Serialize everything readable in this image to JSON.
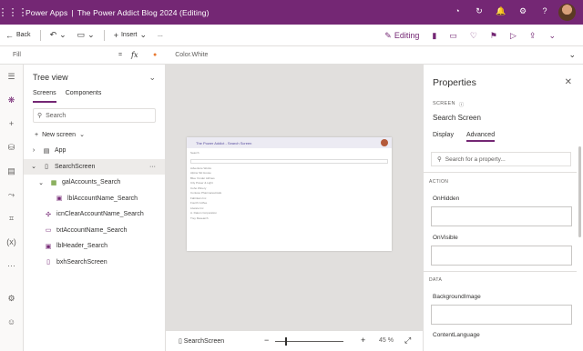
{
  "topbar": {
    "app_name": "Power Apps",
    "separator": "|",
    "doc_title": "The Power Addict Blog 2024 (Editing)"
  },
  "commandbar": {
    "back_label": "Back",
    "insert_label": "Insert",
    "more_label": "...",
    "editing_label": "Editing"
  },
  "formulabar": {
    "property": "Fill",
    "equals": "=",
    "fx": "fx",
    "formula": "Color.White"
  },
  "tree": {
    "title": "Tree view",
    "tabs": [
      "Screens",
      "Components"
    ],
    "search_placeholder": "Search",
    "new_screen": "New screen",
    "nodes": [
      {
        "label": "App",
        "indent": 0
      },
      {
        "label": "SearchScreen",
        "indent": 0
      },
      {
        "label": "galAccounts_Search",
        "indent": 1
      },
      {
        "label": "lblAccountName_Search",
        "indent": 2
      },
      {
        "label": "icnClearAccountName_Search",
        "indent": 1
      },
      {
        "label": "txtAccountName_Search",
        "indent": 1
      },
      {
        "label": "lblHeader_Search",
        "indent": 1
      },
      {
        "label": "bxhSearchScreen",
        "indent": 1
      }
    ],
    "more": "···"
  },
  "canvas": {
    "app_header": "The Power Addict - Search Screen",
    "lines": [
      "Search",
      "",
      "Adventure Works",
      "Alpine Ski House",
      "Blue Yonder Airlines",
      "City Power & Light",
      "Coho Winery",
      "Contoso Pharmaceuticals",
      "Fabrikam Inc",
      "Fourth Coffee",
      "Litware Inc",
      "A. Datum Corporation",
      "Trey Research"
    ]
  },
  "statusbar": {
    "screen_name": "SearchScreen",
    "minus": "−",
    "plus": "+",
    "zoom": "45 %"
  },
  "properties": {
    "title": "Properties",
    "type": "SCREEN",
    "name": "Search Screen",
    "tabs": [
      "Display",
      "Advanced"
    ],
    "search_placeholder": "Search for a property...",
    "sections": [
      {
        "name": "ACTION",
        "fields": [
          "OnHidden",
          "OnVisible"
        ]
      },
      {
        "name": "DATA",
        "fields": [
          "BackgroundImage",
          "ContentLanguage"
        ]
      }
    ]
  }
}
